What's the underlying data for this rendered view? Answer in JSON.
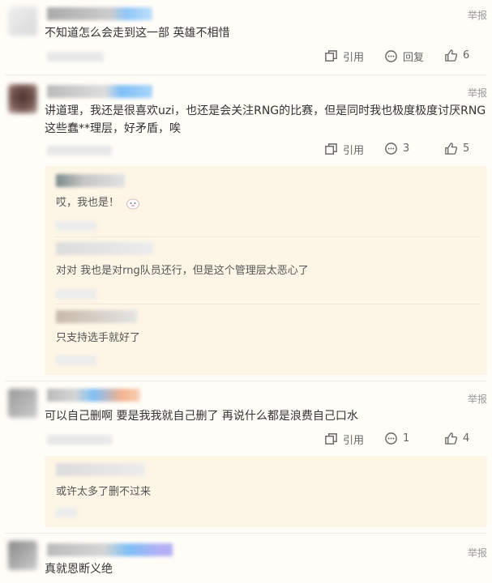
{
  "labels": {
    "report": "举报",
    "quote": "引用",
    "reply": "回复"
  },
  "comments": [
    {
      "text": "不知道怎么会走到这一部 英雄不相惜",
      "comments": "回复",
      "likes": "6"
    },
    {
      "text": "讲道理，我还是很喜欢uzi，也还是会关注RNG的比赛，但是同时我也极度极度讨厌RNG这些蠢**理层，好矛盾，唉",
      "comments": "3",
      "likes": "5",
      "replies": [
        {
          "text": "哎，我也是！"
        },
        {
          "text": "对对 我也是对rng队员还行，但是这个管理层太恶心了"
        },
        {
          "text": "只支持选手就好了"
        }
      ]
    },
    {
      "text": "可以自己删啊 要是我我就自己删了 再说什么都是浪费自己口水",
      "comments": "1",
      "likes": "4",
      "replies": [
        {
          "text": "或许太多了删不过来"
        }
      ]
    },
    {
      "text": "真就恩断义绝"
    }
  ]
}
